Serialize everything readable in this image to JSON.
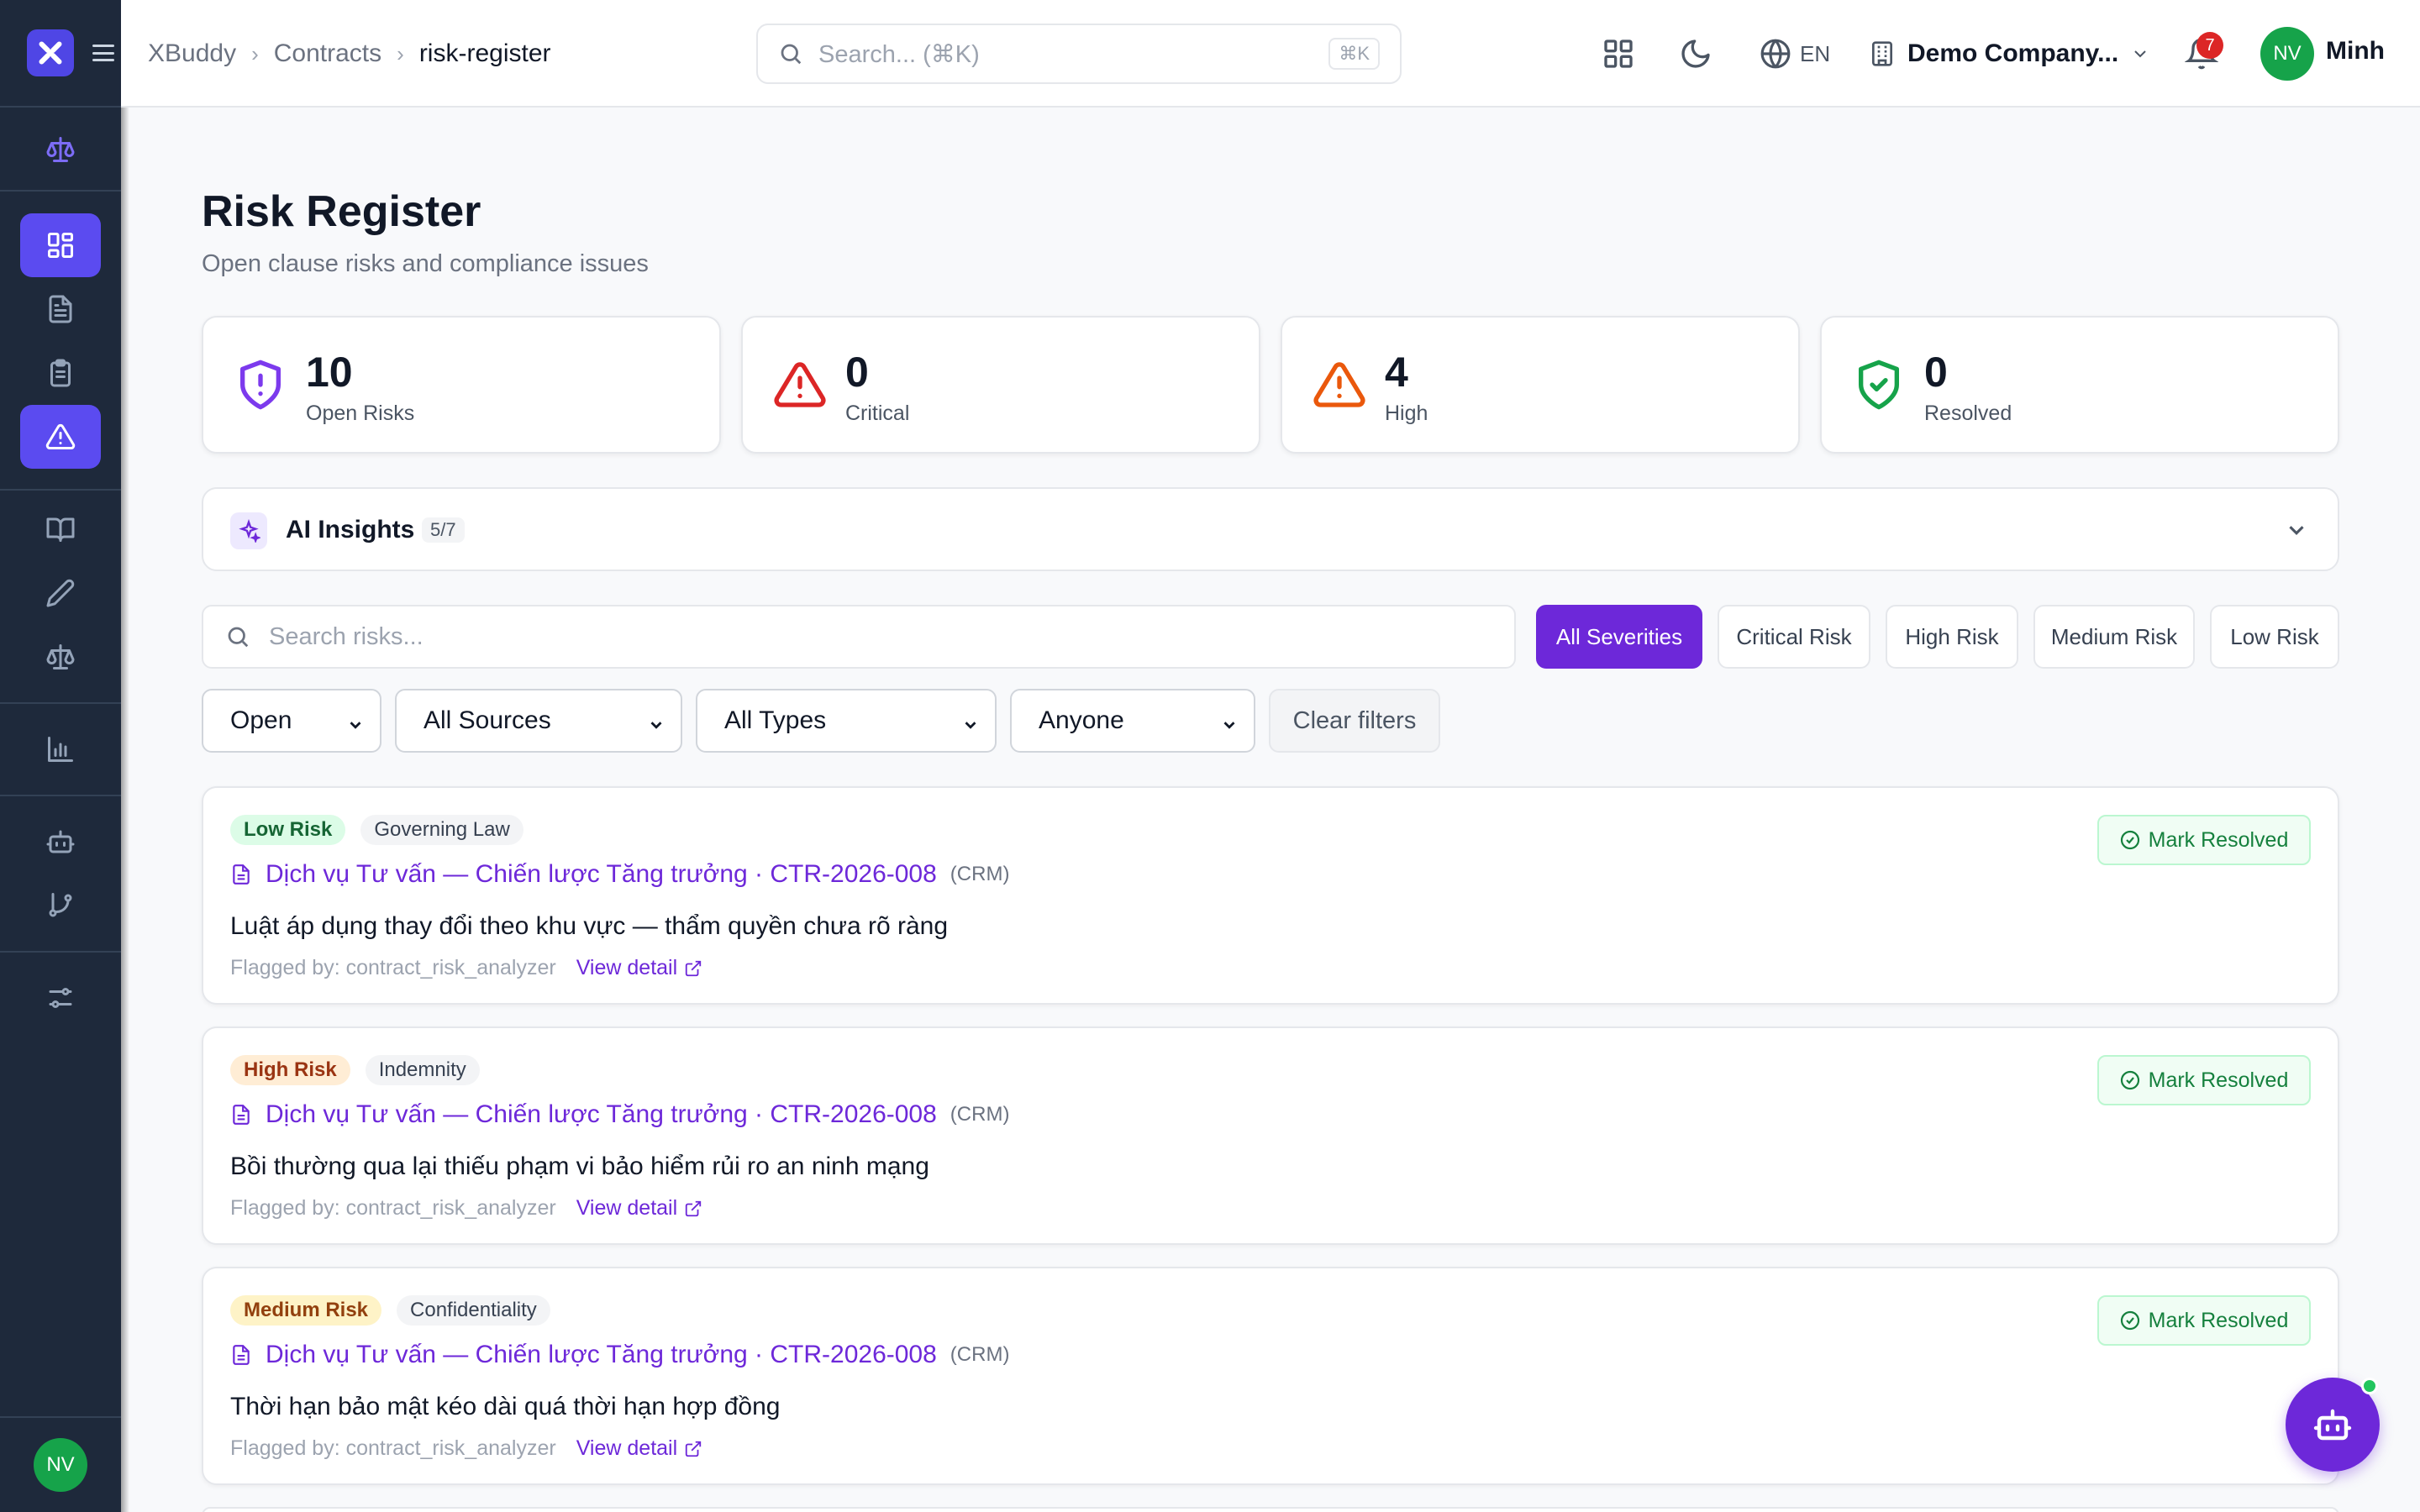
{
  "breadcrumbs": [
    "XBuddy",
    "Contracts",
    "risk-register"
  ],
  "header": {
    "search_placeholder": "Search... (⌘K)",
    "search_shortcut": "⌘K",
    "language": "EN",
    "company": "Demo Company...",
    "notification_count": "7",
    "user_initials": "NV",
    "user_name": "Minh"
  },
  "sidebar": {
    "items": [
      {
        "icon": "scale-icon"
      },
      {
        "icon": "dashboard-icon"
      },
      {
        "icon": "document-icon"
      },
      {
        "icon": "clipboard-icon"
      },
      {
        "icon": "alert-triangle-icon"
      },
      {
        "icon": "book-icon"
      },
      {
        "icon": "pen-icon"
      },
      {
        "icon": "scale-icon"
      },
      {
        "icon": "bar-chart-icon"
      },
      {
        "icon": "robot-icon"
      },
      {
        "icon": "git-branch-icon"
      },
      {
        "icon": "sliders-icon"
      }
    ],
    "user_initials": "NV"
  },
  "page": {
    "title": "Risk Register",
    "subtitle": "Open clause risks and compliance issues"
  },
  "stats": [
    {
      "value": "10",
      "label": "Open Risks",
      "color": "#7c3aed"
    },
    {
      "value": "0",
      "label": "Critical",
      "color": "#dc2626"
    },
    {
      "value": "4",
      "label": "High",
      "color": "#ea580c"
    },
    {
      "value": "0",
      "label": "Resolved",
      "color": "#16a34a"
    }
  ],
  "insights": {
    "title": "AI Insights",
    "count": "5/7"
  },
  "filters": {
    "search_placeholder": "Search risks...",
    "severity_buttons": [
      "All Severities",
      "Critical Risk",
      "High Risk",
      "Medium Risk",
      "Low Risk"
    ],
    "active_severity": "All Severities",
    "selects": [
      "Open",
      "All Sources",
      "All Types",
      "Anyone"
    ],
    "clear_label": "Clear filters"
  },
  "risks": [
    {
      "severity": "Low Risk",
      "category": "Governing Law",
      "contract": "Dịch vụ Tư vấn — Chiến lược Tăng trưởng · CTR-2026-008",
      "source": "(CRM)",
      "description": "Luật áp dụng thay đổi theo khu vực — thẩm quyền chưa rõ ràng",
      "flagged_by": "Flagged by: contract_risk_analyzer",
      "view_label": "View detail",
      "action_label": "Mark Resolved"
    },
    {
      "severity": "High Risk",
      "category": "Indemnity",
      "contract": "Dịch vụ Tư vấn — Chiến lược Tăng trưởng · CTR-2026-008",
      "source": "(CRM)",
      "description": "Bồi thường qua lại thiếu phạm vi bảo hiểm rủi ro an ninh mạng",
      "flagged_by": "Flagged by: contract_risk_analyzer",
      "view_label": "View detail",
      "action_label": "Mark Resolved"
    },
    {
      "severity": "Medium Risk",
      "category": "Confidentiality",
      "contract": "Dịch vụ Tư vấn — Chiến lược Tăng trưởng · CTR-2026-008",
      "source": "(CRM)",
      "description": "Thời hạn bảo mật kéo dài quá thời hạn hợp đồng",
      "flagged_by": "Flagged by: contract_risk_analyzer",
      "view_label": "View detail",
      "action_label": "Mark Resolved"
    }
  ]
}
